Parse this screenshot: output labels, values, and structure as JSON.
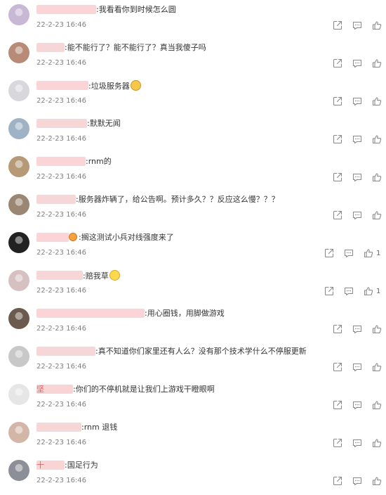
{
  "comments": [
    {
      "text": ":我看看你到时候怎么圆",
      "time": "22-2-23 16:46",
      "likes": ""
    },
    {
      "text": ":能不能行了？能不能行了？真当我傻子吗",
      "time": "22-2-23 16:46",
      "likes": ""
    },
    {
      "text": ":垃圾服务器",
      "time": "22-2-23 16:46",
      "likes": "",
      "emoji": "cat-emoji"
    },
    {
      "text": ":默默无闻",
      "time": "22-2-23 16:46",
      "likes": ""
    },
    {
      "text": ":rnm的",
      "time": "22-2-23 16:46",
      "likes": ""
    },
    {
      "text": ":服务器炸辆了，给公告啊。预计多久？？反应这么慢？？？",
      "time": "22-2-23 16:46",
      "likes": ""
    },
    {
      "text": ":搁这测试小兵对线强度来了",
      "time": "22-2-23 16:46",
      "likes": "1",
      "emoji_prefix": "angry-emoji"
    },
    {
      "text": ":赔我草",
      "time": "22-2-23 16:46",
      "likes": "1",
      "emoji": "smile-emoji"
    },
    {
      "text": ":用心圈钱，用脚做游戏",
      "time": "22-2-23 16:46",
      "likes": ""
    },
    {
      "text": ":真不知道你们家里还有人么？没有那个技术学什么不停服更新",
      "time": "22-2-23 16:46",
      "likes": ""
    },
    {
      "text": ":你们的不停机就是让我们上游戏干瞪眼啊",
      "time": "22-2-23 16:46",
      "likes": ""
    },
    {
      "text": ":rnm 退钱",
      "time": "22-2-23 16:46",
      "likes": ""
    },
    {
      "text": ":国足行为",
      "time": "22-2-23 16:46",
      "likes": ""
    }
  ],
  "partial_name_chars": [
    "坚",
    "十"
  ],
  "icons": {
    "share": "share-icon",
    "comment": "comment-icon",
    "like": "like-icon"
  },
  "colors": {
    "time": "#808080",
    "icon": "#8a8a8a",
    "redaction": "#f8c6c8"
  }
}
